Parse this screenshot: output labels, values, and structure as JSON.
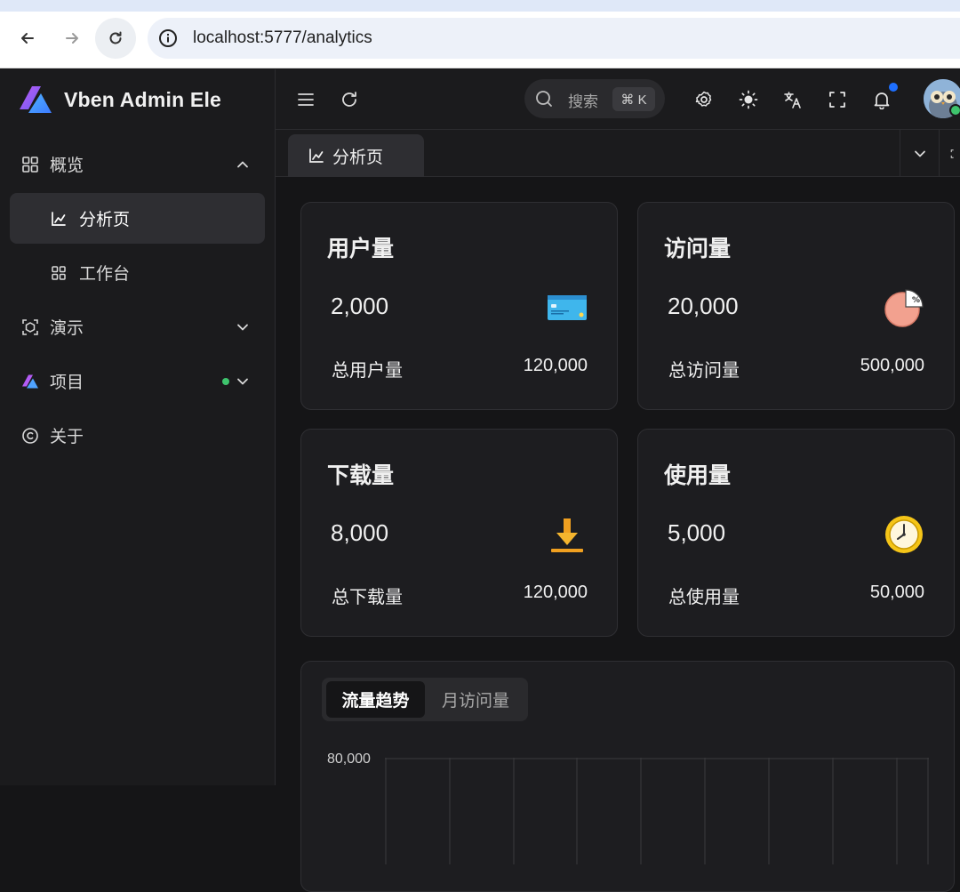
{
  "browser": {
    "url": "localhost:5777/analytics"
  },
  "app": {
    "name": "Vben Admin Ele"
  },
  "sidebar": {
    "items": [
      {
        "label": "概览",
        "icon": "dashboard-grid-icon",
        "expanded": true
      },
      {
        "label": "分析页",
        "icon": "area-chart-icon",
        "active": true
      },
      {
        "label": "工作台",
        "icon": "workspace-grid-icon"
      },
      {
        "label": "演示",
        "icon": "demo-box-icon",
        "expanded": false
      },
      {
        "label": "项目",
        "icon": "vben-logo-icon",
        "expanded": false,
        "badge_dot": "#3ec46d"
      },
      {
        "label": "关于",
        "icon": "copyright-icon"
      }
    ]
  },
  "header": {
    "search_label": "搜索",
    "search_shortcut": "⌘ K",
    "notification_dot_color": "#1e6fff"
  },
  "tabs": [
    {
      "label": "分析页",
      "icon": "area-chart-icon"
    }
  ],
  "cards": [
    {
      "title": "用户量",
      "value": "2,000",
      "total_label": "总用户量",
      "total_value": "120,000",
      "icon": "credit-card-icon"
    },
    {
      "title": "访问量",
      "value": "20,000",
      "total_label": "总访问量",
      "total_value": "500,000",
      "icon": "pie-chart-icon"
    },
    {
      "title": "下载量",
      "value": "8,000",
      "total_label": "总下载量",
      "total_value": "120,000",
      "icon": "download-icon"
    },
    {
      "title": "使用量",
      "value": "5,000",
      "total_label": "总使用量",
      "total_value": "50,000",
      "icon": "clock-icon"
    }
  ],
  "chart_panel": {
    "tabs": [
      "流量趋势",
      "月访问量"
    ],
    "active_tab": "流量趋势",
    "y_tick_top": "80,000"
  },
  "colors": {
    "background": "#151517",
    "sidebar": "#1b1b1d",
    "card": "#1d1d20",
    "active_item": "#2e2e32"
  }
}
